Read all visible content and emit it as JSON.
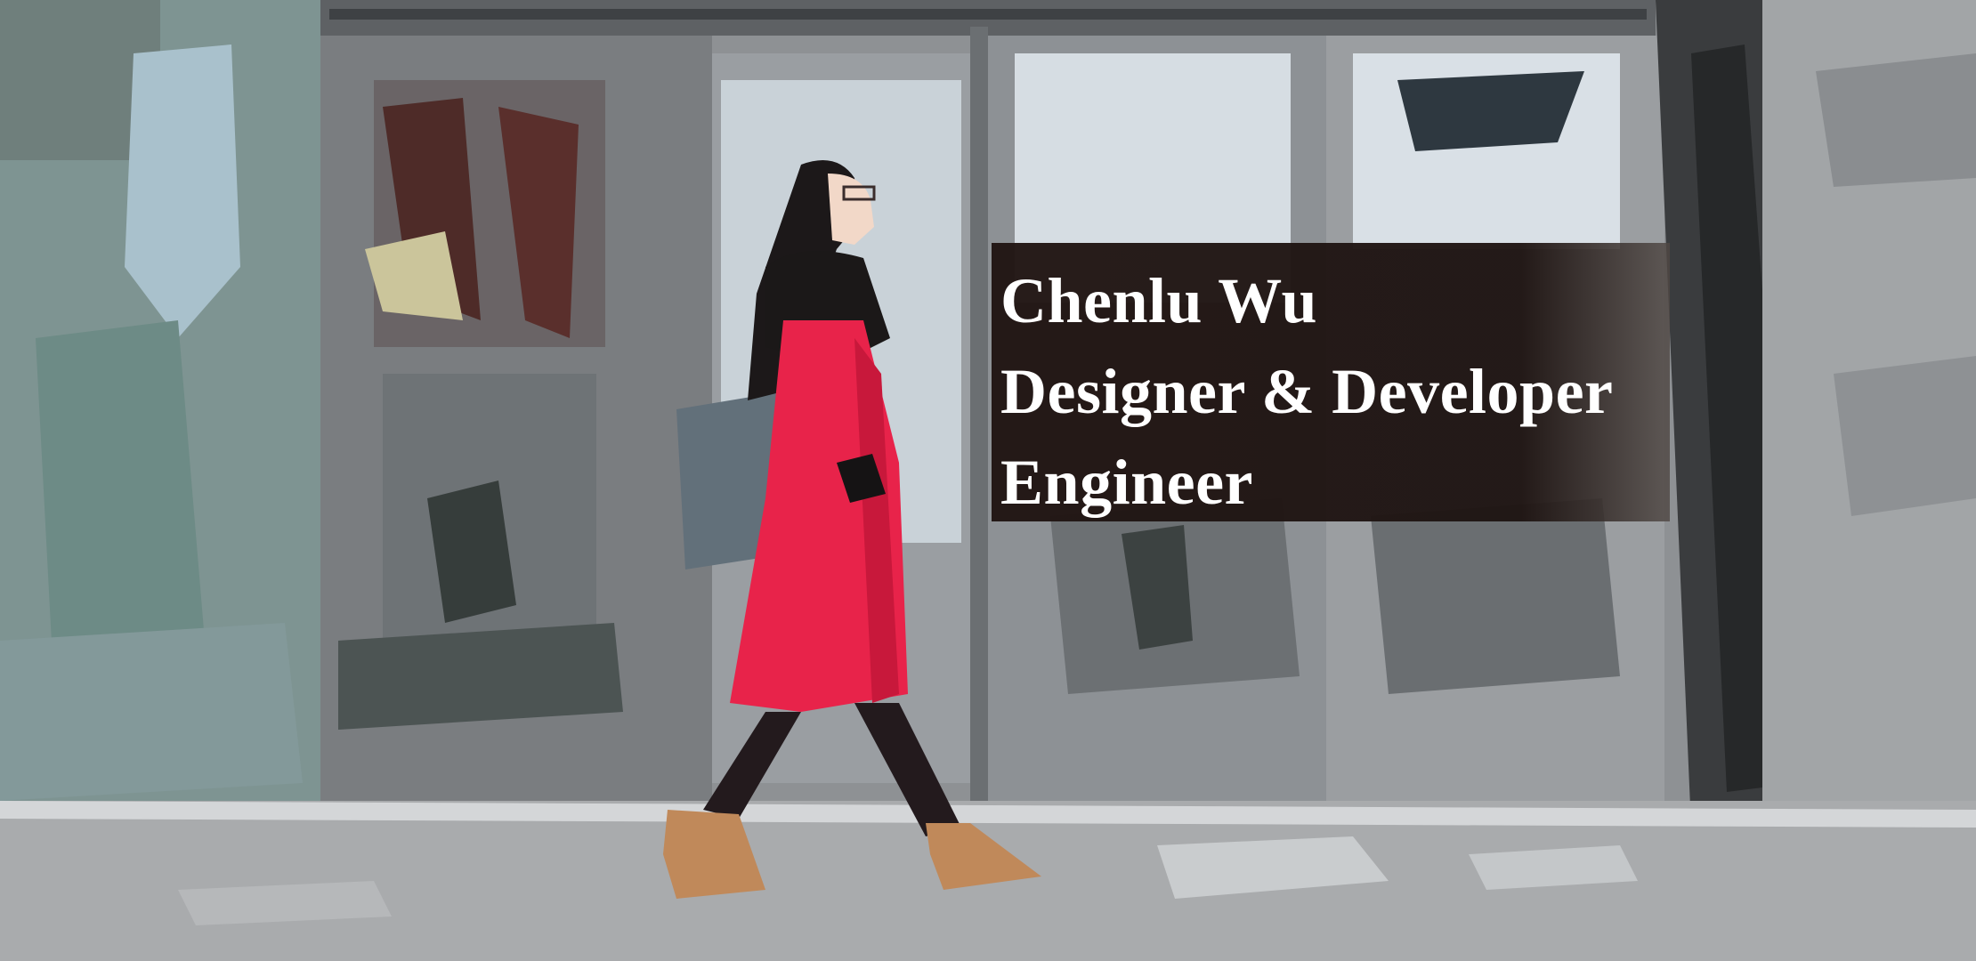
{
  "hero": {
    "name": "Chenlu Wu",
    "role_line_1": "Designer & Developer",
    "role_line_2": "Engineer"
  },
  "colors": {
    "caption_background": "#201412",
    "caption_text": "#ffffff",
    "coat": "#e8234a",
    "boots": "#c0895a",
    "wall_gray": "#8c8f92"
  }
}
